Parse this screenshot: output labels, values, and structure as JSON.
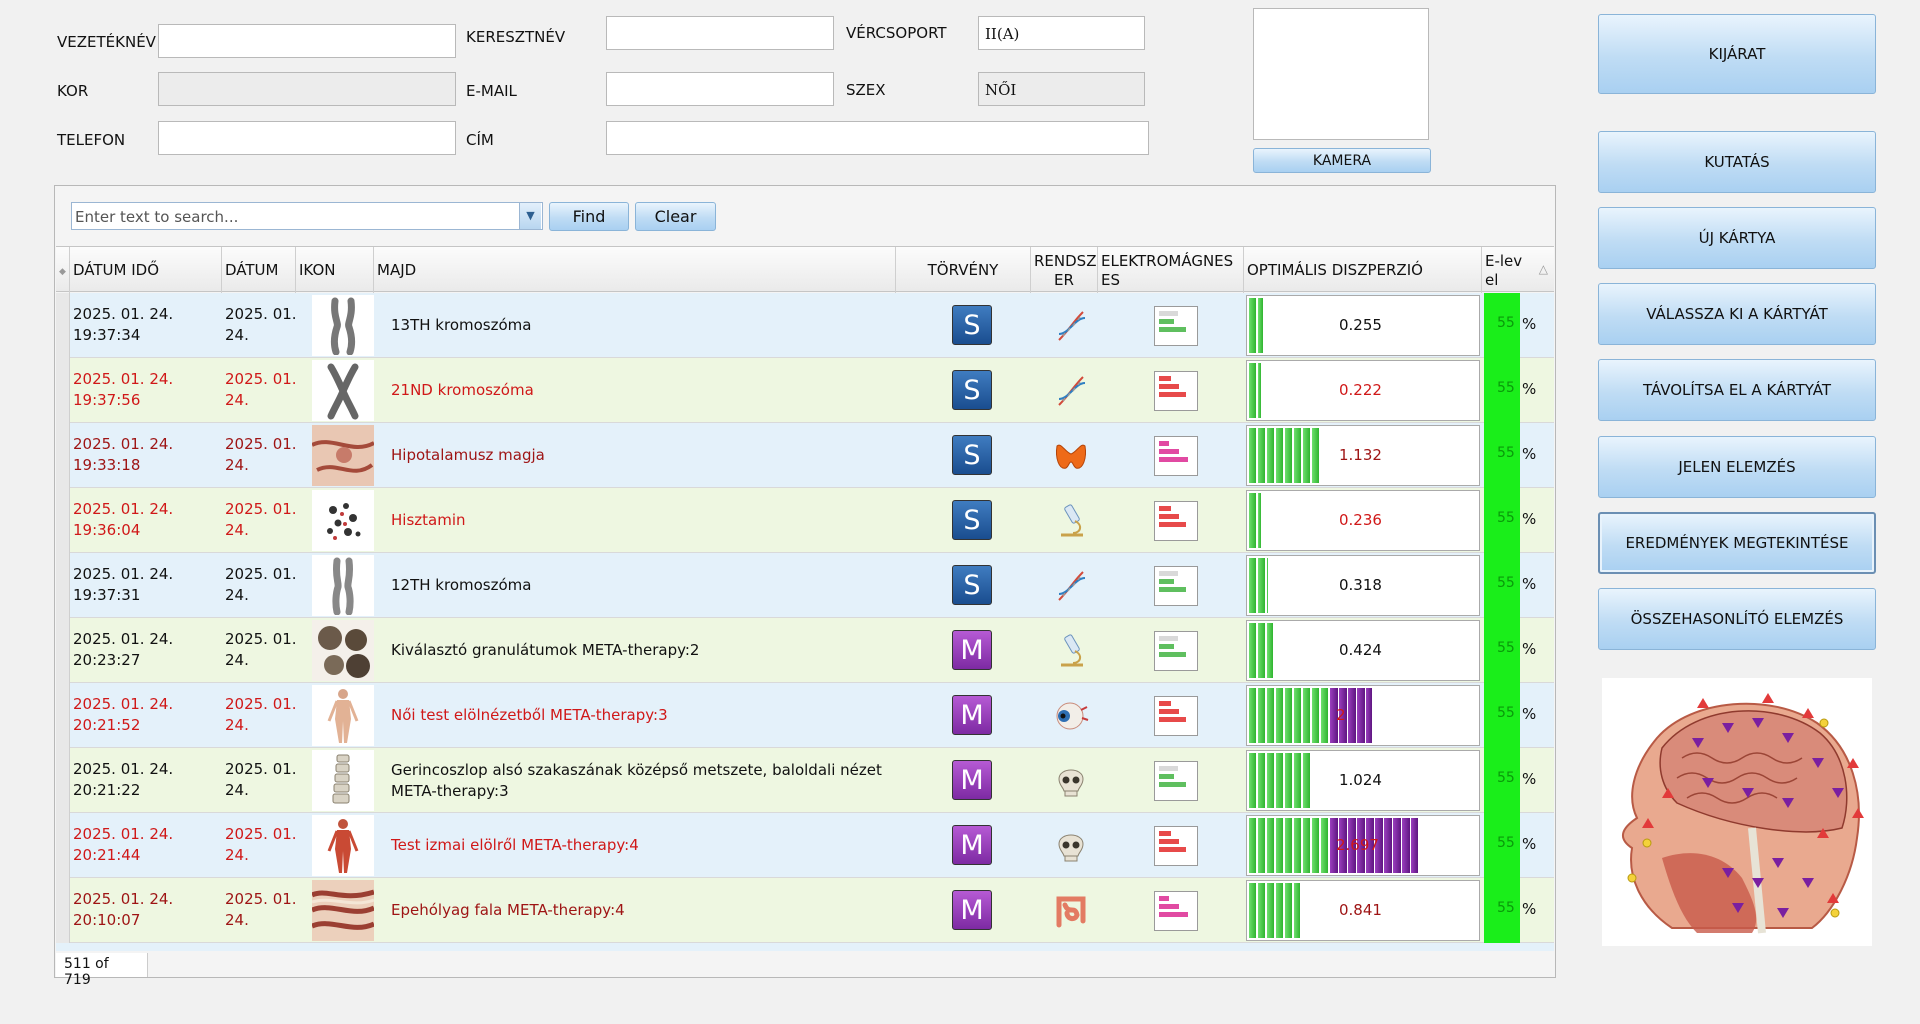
{
  "form": {
    "surname_label": "VEZETÉKNÉV",
    "surname_value": "",
    "firstname_label": "KERESZTNÉV",
    "firstname_value": "",
    "bloodtype_label": "VÉRCSOPORT",
    "bloodtype_value": "II(A)",
    "age_label": "KOR",
    "age_value": "",
    "email_label": "E-MAIL",
    "email_value": "",
    "sex_label": "SZEX",
    "sex_value": "NŐI",
    "phone_label": "TELEFON",
    "phone_value": "",
    "address_label": "CÍM",
    "address_value": "",
    "camera_button": "KAMERA"
  },
  "sidebar": {
    "buttons": [
      {
        "label": "KIJÁRAT"
      },
      {
        "label": "KUTATÁS"
      },
      {
        "label": "ÚJ KÁRTYA"
      },
      {
        "label": "VÁLASSZA KI A KÁRTYÁT"
      },
      {
        "label": "TÁVOLÍTSA EL A KÁRTYÁT"
      },
      {
        "label": "JELEN ELEMZÉS"
      },
      {
        "label": "EREDMÉNYEK MEGTEKINTÉSE"
      },
      {
        "label": "ÖSSZEHASONLÍTÓ ELEMZÉS"
      }
    ],
    "active_index": 6
  },
  "search": {
    "placeholder": "Enter text to search...",
    "find_label": "Find",
    "clear_label": "Clear"
  },
  "grid": {
    "columns": {
      "datetime": "DÁTUM IDŐ",
      "date": "DÁTUM",
      "icon": "IKON",
      "name": "MAJD",
      "law": "TÖRVÉNY",
      "system_l1": "RENDSZ",
      "system_l2": "ER",
      "em_l1": "ELEKTROMÁGNES",
      "em_l2": "ES",
      "dispersion": "OPTIMÁLIS DISZPERZIÓ",
      "elevel_l1": "E-lev",
      "elevel_l2": "el"
    },
    "percent_sign": "%",
    "rows": [
      {
        "dt1": "2025. 01. 24.",
        "dt2": "19:37:34",
        "d1": "2025. 01.",
        "d2": "24.",
        "name": "13TH kromoszóma",
        "name2": "",
        "law": "S",
        "system_icon": "dna-icon",
        "em": "normal",
        "disp": "0.255",
        "disp_fill": 0.07,
        "disp_violet": 0,
        "elevel": "55",
        "color": "normal"
      },
      {
        "dt1": "2025. 01. 24.",
        "dt2": "19:37:56",
        "d1": "2025. 01.",
        "d2": "24.",
        "name": "21ND kromoszóma",
        "name2": "",
        "law": "S",
        "system_icon": "dna-icon",
        "em": "alert",
        "disp": "0.222",
        "disp_fill": 0.06,
        "disp_violet": 0,
        "elevel": "55",
        "color": "red"
      },
      {
        "dt1": "2025. 01. 24.",
        "dt2": "19:33:18",
        "d1": "2025. 01.",
        "d2": "24.",
        "name": "Hipotalamusz magja",
        "name2": "",
        "law": "S",
        "system_icon": "thyroid-icon",
        "em": "pink",
        "disp": "1.132",
        "disp_fill": 0.31,
        "disp_violet": 0,
        "elevel": "55",
        "color": "darkred"
      },
      {
        "dt1": "2025. 01. 24.",
        "dt2": "19:36:04",
        "d1": "2025. 01.",
        "d2": "24.",
        "name": "Hisztamin",
        "name2": "",
        "law": "S",
        "system_icon": "microscope-icon",
        "em": "alert",
        "disp": "0.236",
        "disp_fill": 0.06,
        "disp_violet": 0,
        "elevel": "55",
        "color": "red"
      },
      {
        "dt1": "2025. 01. 24.",
        "dt2": "19:37:31",
        "d1": "2025. 01.",
        "d2": "24.",
        "name": "12TH kromoszóma",
        "name2": "",
        "law": "S",
        "system_icon": "dna-icon",
        "em": "normal",
        "disp": "0.318",
        "disp_fill": 0.09,
        "disp_violet": 0,
        "elevel": "55",
        "color": "normal"
      },
      {
        "dt1": "2025. 01. 24.",
        "dt2": "20:23:27",
        "d1": "2025. 01.",
        "d2": "24.",
        "name": "Kiválasztó granulátumok META-therapy:2",
        "name2": "",
        "law": "M",
        "system_icon": "microscope-icon",
        "em": "normal",
        "disp": "0.424",
        "disp_fill": 0.11,
        "disp_violet": 0,
        "elevel": "55",
        "color": "normal"
      },
      {
        "dt1": "2025. 01. 24.",
        "dt2": "20:21:52",
        "d1": "2025. 01.",
        "d2": "24.",
        "name": "Női test elölnézetből META-therapy:3",
        "name2": "",
        "law": "M",
        "system_icon": "eye-icon",
        "em": "alert",
        "disp": "2",
        "disp_fill": 0.35,
        "disp_violet": 0.18,
        "elevel": "55",
        "color": "red"
      },
      {
        "dt1": "2025. 01. 24.",
        "dt2": "20:21:22",
        "d1": "2025. 01.",
        "d2": "24.",
        "name": "Gerincoszlop alsó szakaszának középső metszete, baloldali nézet",
        "name2": "META-therapy:3",
        "law": "M",
        "system_icon": "skull-icon",
        "em": "normal",
        "disp": "1.024",
        "disp_fill": 0.28,
        "disp_violet": 0,
        "elevel": "55",
        "color": "normal"
      },
      {
        "dt1": "2025. 01. 24.",
        "dt2": "20:21:44",
        "d1": "2025. 01.",
        "d2": "24.",
        "name": "Test izmai elölről META-therapy:4",
        "name2": "",
        "law": "M",
        "system_icon": "skull-icon",
        "em": "alert",
        "disp": "2.697",
        "disp_fill": 0.35,
        "disp_violet": 0.38,
        "elevel": "55",
        "color": "red"
      },
      {
        "dt1": "2025. 01. 24.",
        "dt2": "20:10:07",
        "d1": "2025. 01.",
        "d2": "24.",
        "name": "Epehólyag fala META-therapy:4",
        "name2": "",
        "law": "M",
        "system_icon": "intestine-icon",
        "em": "pink",
        "disp": "0.841",
        "disp_fill": 0.23,
        "disp_violet": 0,
        "elevel": "55",
        "color": "darkred"
      }
    ],
    "status": "511 of 719"
  },
  "colors": {
    "accent_blue": "#bfdcf4",
    "row_blue": "#e4f1fa",
    "row_green": "#eef7e1",
    "red_text": "#d01818",
    "elevel_green": "#1aee1a",
    "bar_green": "#3cc43c",
    "bar_violet": "#7b1fa2"
  }
}
